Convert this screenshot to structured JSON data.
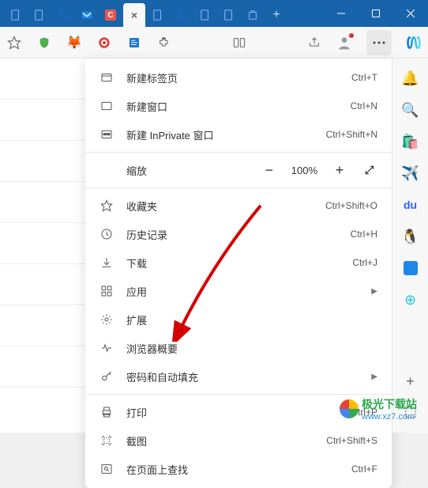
{
  "tabs": {
    "items": [
      {
        "icon": "page"
      },
      {
        "icon": "page"
      },
      {
        "icon": "baidu"
      },
      {
        "icon": "mail"
      },
      {
        "icon": "c-red"
      },
      {
        "icon": "active"
      },
      {
        "icon": "page"
      },
      {
        "icon": "baidu"
      },
      {
        "icon": "page"
      },
      {
        "icon": "page"
      },
      {
        "icon": "bag"
      }
    ]
  },
  "toolbar": {
    "star": "☆",
    "shield": "🛡",
    "cat": "🐱",
    "target": "🎯"
  },
  "menu": {
    "new_tab": "新建标签页",
    "new_tab_key": "Ctrl+T",
    "new_window": "新建窗口",
    "new_window_key": "Ctrl+N",
    "new_inprivate": "新建 InPrivate 窗口",
    "new_inprivate_key": "Ctrl+Shift+N",
    "zoom": "缩放",
    "zoom_value": "100%",
    "favorites": "收藏夹",
    "favorites_key": "Ctrl+Shift+O",
    "history": "历史记录",
    "history_key": "Ctrl+H",
    "downloads": "下载",
    "downloads_key": "Ctrl+J",
    "apps": "应用",
    "extensions": "扩展",
    "browser_essentials": "浏览器概要",
    "passwords": "密码和自动填充",
    "print": "打印",
    "print_key": "Ctrl+P",
    "screenshot": "截图",
    "screenshot_key": "Ctrl+Shift+S",
    "find": "在页面上查找",
    "find_key": "Ctrl+F"
  },
  "watermark": {
    "name": "极光下载站",
    "url": "www.xz7.com"
  }
}
